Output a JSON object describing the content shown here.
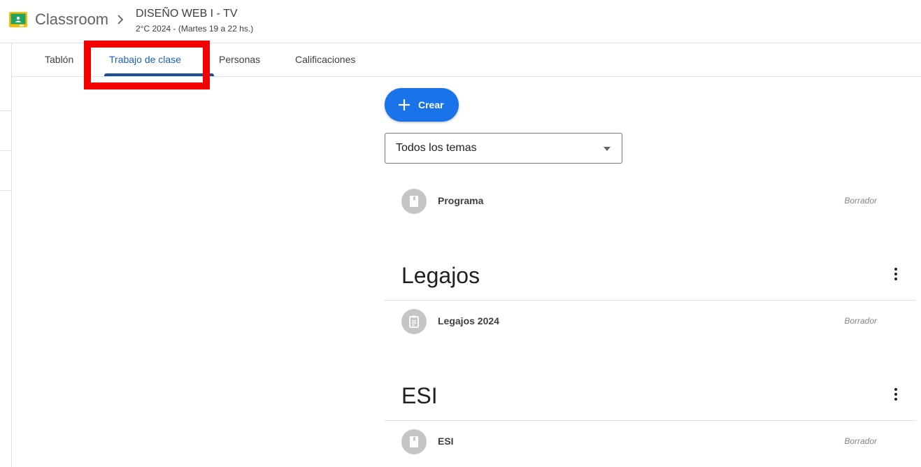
{
  "header": {
    "app_name": "Classroom",
    "course_title": "DISEÑO WEB I - TV",
    "course_subtitle": "2°C 2024 - (Martes 19 a 22 hs.)"
  },
  "tabs": [
    {
      "label": "Tablón",
      "active": false
    },
    {
      "label": "Trabajo de clase",
      "active": true
    },
    {
      "label": "Personas",
      "active": false
    },
    {
      "label": "Calificaciones",
      "active": false
    }
  ],
  "create_button": {
    "label": "Crear"
  },
  "topic_filter": {
    "selected": "Todos los temas"
  },
  "ungrouped_items": [
    {
      "title": "Programa",
      "icon": "material-icon",
      "status": "Borrador"
    }
  ],
  "topics": [
    {
      "name": "Legajos",
      "items": [
        {
          "title": "Legajos 2024",
          "icon": "assignment-icon",
          "status": "Borrador"
        }
      ]
    },
    {
      "name": "ESI",
      "items": [
        {
          "title": "ESI",
          "icon": "material-icon",
          "status": "Borrador"
        }
      ]
    }
  ],
  "colors": {
    "accent": "#1a73e8",
    "active_tab": "#1e5fbd",
    "highlight": "#f40000"
  }
}
